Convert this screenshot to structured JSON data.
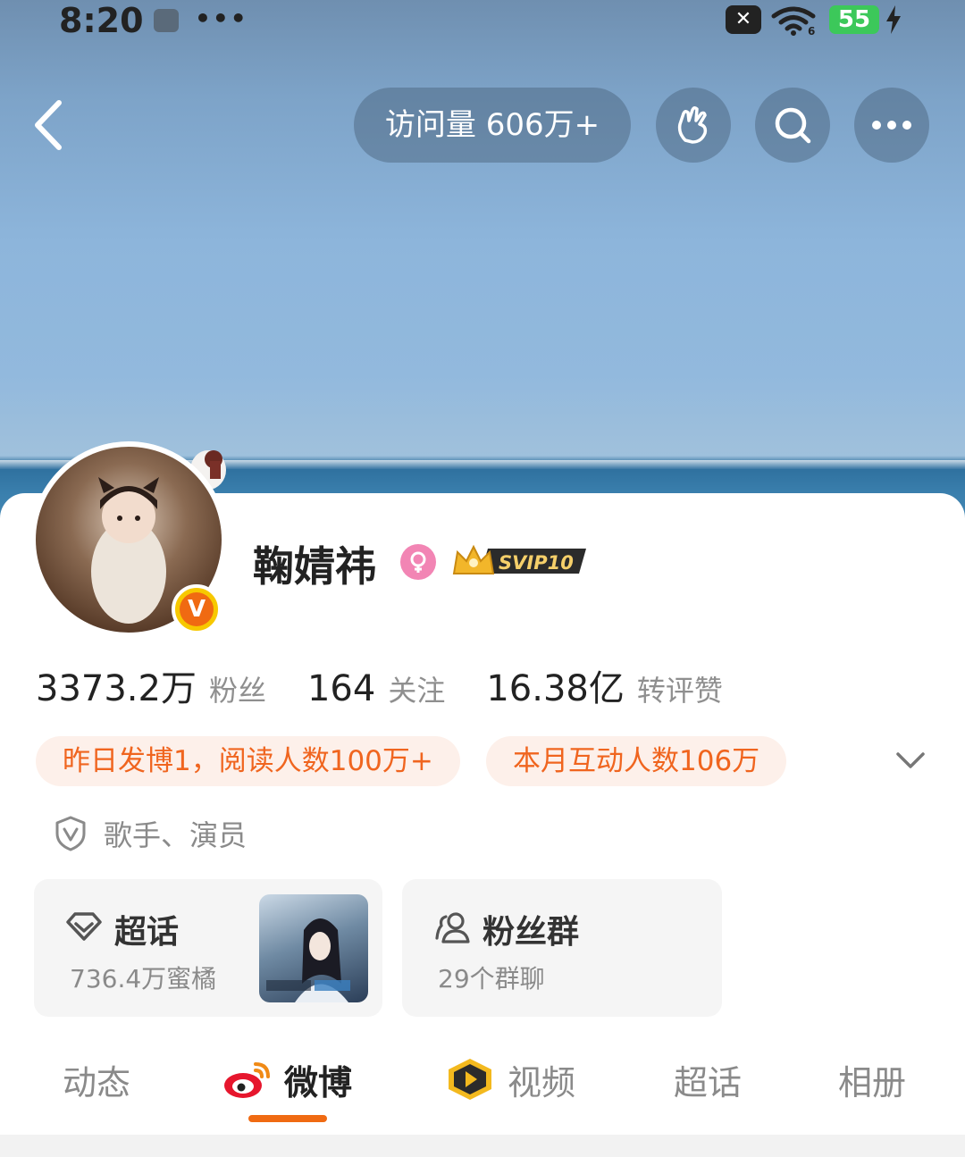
{
  "status_bar": {
    "time": "8:20",
    "dots": "•••",
    "battery": "55"
  },
  "header": {
    "visits_label": "访问量 606万+",
    "buttons": [
      "wave-icon",
      "search-icon",
      "more-icon"
    ]
  },
  "profile": {
    "name": "鞠婧祎",
    "svip": "SVIP10",
    "verify_mark": "V"
  },
  "stats": [
    {
      "value": "3373.2万",
      "label": "粉丝"
    },
    {
      "value": "164",
      "label": "关注"
    },
    {
      "value": "16.38亿",
      "label": "转评赞"
    }
  ],
  "pills": [
    "昨日发博1，阅读人数100万+",
    "本月互动人数106万"
  ],
  "role": {
    "text": "歌手、演员"
  },
  "cards": {
    "supertopic": {
      "title": "超话",
      "sub": "736.4万蜜橘"
    },
    "fan_group": {
      "title": "粉丝群",
      "sub": "29个群聊"
    }
  },
  "tabs": [
    {
      "label": "动态",
      "active": false
    },
    {
      "label": "微博",
      "active": true
    },
    {
      "label": "视频",
      "active": false
    },
    {
      "label": "超话",
      "active": false
    },
    {
      "label": "相册",
      "active": false
    }
  ],
  "colors": {
    "accent": "#f06a12",
    "pill_bg": "#fdf0ea",
    "card_bg": "#f5f5f5"
  }
}
